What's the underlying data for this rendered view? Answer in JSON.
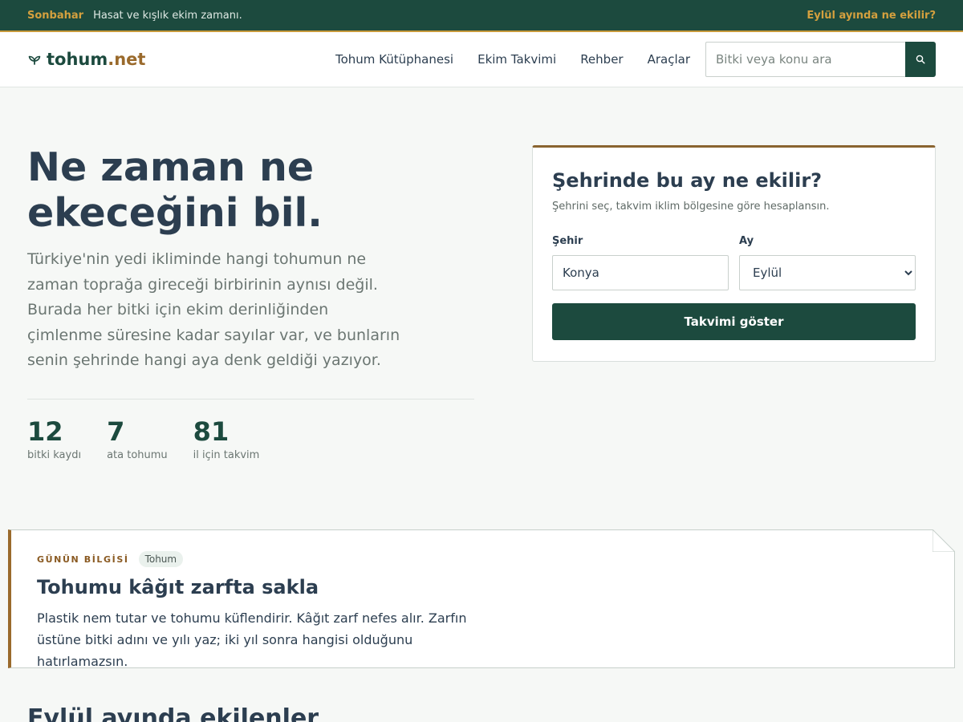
{
  "topbar": {
    "season": "Sonbahar",
    "message": "Hasat ve kışlık ekim zamanı.",
    "cta": "Eylül ayında ne ekilir?"
  },
  "header": {
    "logo_name": "tohum",
    "logo_tld": ".net",
    "nav": [
      "Tohum Kütüphanesi",
      "Ekim Takvimi",
      "Rehber",
      "Araçlar"
    ],
    "search_placeholder": "Bitki veya konu ara"
  },
  "hero": {
    "title": "Ne zaman ne ekeceğini bil.",
    "lead": "Türkiye'nin yedi ikliminde hangi tohumun ne zaman toprağa gireceği birbirinin aynısı değil. Burada her bitki için ekim derinliğinden çimlenme süresine kadar sayılar var, ve bunların senin şehrinde hangi aya denk geldiği yazıyor.",
    "stats": [
      {
        "value": "12",
        "label": "bitki kaydı"
      },
      {
        "value": "7",
        "label": "ata tohumu"
      },
      {
        "value": "81",
        "label": "il için takvim"
      }
    ]
  },
  "planner": {
    "title": "Şehrinde bu ay ne ekilir?",
    "subtitle": "Şehrini seç, takvim iklim bölgesine göre hesaplansın.",
    "city_label": "Şehir",
    "city_value": "Konya",
    "month_label": "Ay",
    "month_value": "Eylül",
    "submit": "Takvimi göster"
  },
  "tip": {
    "kicker": "GÜNÜN BİLGİSİ",
    "tag": "Tohum",
    "title": "Tohumu kâğıt zarfta sakla",
    "body": "Plastik nem tutar ve tohumu küflendirir. Kâğıt zarf nefes alır. Zarfın üstüne bitki adını ve yılı yaz; iki yıl sonra hangisi olduğunu hatırlamazsın."
  },
  "section": {
    "title": "Eylül ayında ekilenler"
  },
  "colors": {
    "brand_green": "#1c4a3e",
    "accent_gold": "#d4a03e",
    "accent_brown": "#9a6a2c"
  }
}
